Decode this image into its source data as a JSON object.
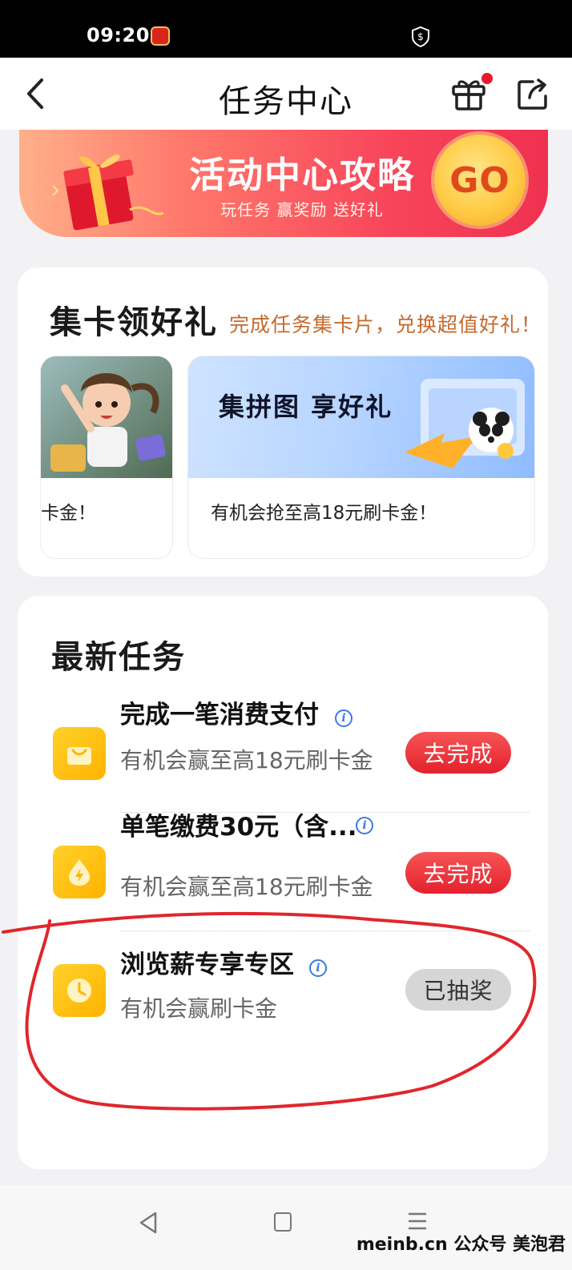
{
  "status_bar": {
    "time": "09:20",
    "app_icon": "app-notification-icon",
    "shield": "shield-dollar-icon"
  },
  "nav": {
    "title": "任务中心",
    "back_icon": "chevron-left-icon",
    "gift_icon": "gift-icon",
    "share_icon": "share-icon",
    "gift_badge_color": "#e8182c"
  },
  "banner": {
    "title": "活动中心攻略",
    "subtitle": "玩任务 赢奖励 送好礼",
    "go_label": "GO"
  },
  "collect_cards": {
    "title": "集卡领好礼",
    "subtitle": "完成任务集卡片，兑换超值好礼！",
    "cards": [
      {
        "text": "卡金！"
      },
      {
        "image_title": "集拼图 享好礼",
        "text": "有机会抢至高18元刷卡金！"
      }
    ]
  },
  "tasks": {
    "title": "最新任务",
    "items": [
      {
        "title": "完成一笔消费支付",
        "desc": "有机会赢至高18元刷卡金",
        "button": "去完成",
        "icon": "shopping-bag-icon",
        "state": "active"
      },
      {
        "title": "单笔缴费30元（含...",
        "desc": "有机会赢至高18元刷卡金",
        "button": "去完成",
        "icon": "lightning-drop-icon",
        "state": "active"
      },
      {
        "title": "浏览薪专享专区",
        "desc": "有机会赢刷卡金",
        "button": "已抽奖",
        "icon": "clock-icon",
        "state": "done"
      }
    ]
  },
  "bottom_bar": {
    "watermark": "meinb.cn  公众号 美泡君"
  },
  "colors": {
    "accent_red": "#e4212d",
    "brand_yellow": "#ffb300",
    "annotation_red": "#e0262c"
  }
}
